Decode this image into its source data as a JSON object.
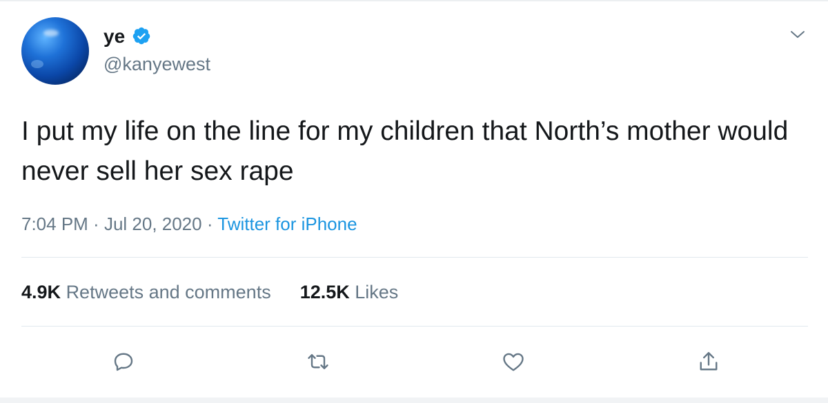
{
  "author": {
    "display_name": "ye",
    "handle": "@kanyewest",
    "verified_icon": "verified-badge-icon",
    "avatar_colors": [
      "#5fb4ff",
      "#1f72d8",
      "#0b47a8",
      "#05235a"
    ]
  },
  "tweet": {
    "text": "I put my life on the line for my children that North’s mother would never sell her sex rape"
  },
  "meta": {
    "time": "7:04 PM",
    "separator": " · ",
    "date": "Jul 20, 2020",
    "source": "Twitter for iPhone"
  },
  "stats": {
    "retweets_count": "4.9K",
    "retweets_label": "Retweets and comments",
    "likes_count": "12.5K",
    "likes_label": "Likes"
  },
  "actions": {
    "reply_icon": "reply-icon",
    "retweet_icon": "retweet-icon",
    "like_icon": "heart-icon",
    "share_icon": "share-icon",
    "more_icon": "chevron-down-icon"
  },
  "colors": {
    "text": "#14171a",
    "secondary": "#657786",
    "link": "#1b95e0",
    "verified": "#1da1f2",
    "divider": "#e1e8ed"
  }
}
